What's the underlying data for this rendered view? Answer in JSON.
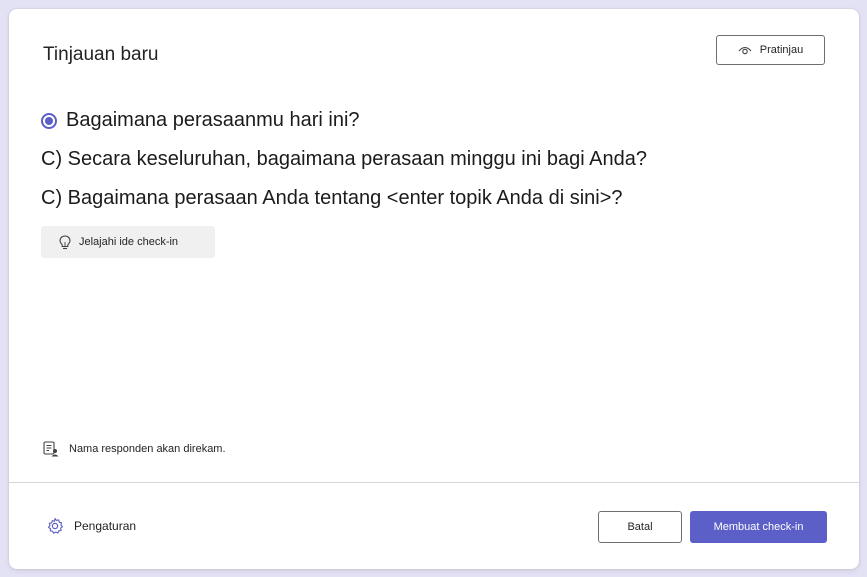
{
  "dialog": {
    "title": "Tinjauan baru",
    "preview_button": {
      "label": "Pratinjau",
      "icon": "eye-icon"
    }
  },
  "questions": [
    {
      "text": "Bagaimana perasaanmu hari ini?",
      "selected": true
    },
    {
      "text": "C) Secara keseluruhan, bagaimana perasaan minggu ini bagi Anda?"
    },
    {
      "text": "C) Bagaimana perasaan Anda tentang <enter topik Anda di sini>?"
    }
  ],
  "explore_button": {
    "label": "Jelajahi ide check-in",
    "icon": "lightbulb-icon"
  },
  "record_note": {
    "text": "Nama responden akan direkam.",
    "icon": "person-list-icon"
  },
  "footer": {
    "settings_label": "Pengaturan",
    "settings_icon": "gear-icon",
    "cancel_label": "Batal",
    "create_label": "Membuat check-in"
  },
  "colors": {
    "accent": "#5b5fc7",
    "background": "#e3e1f4"
  }
}
